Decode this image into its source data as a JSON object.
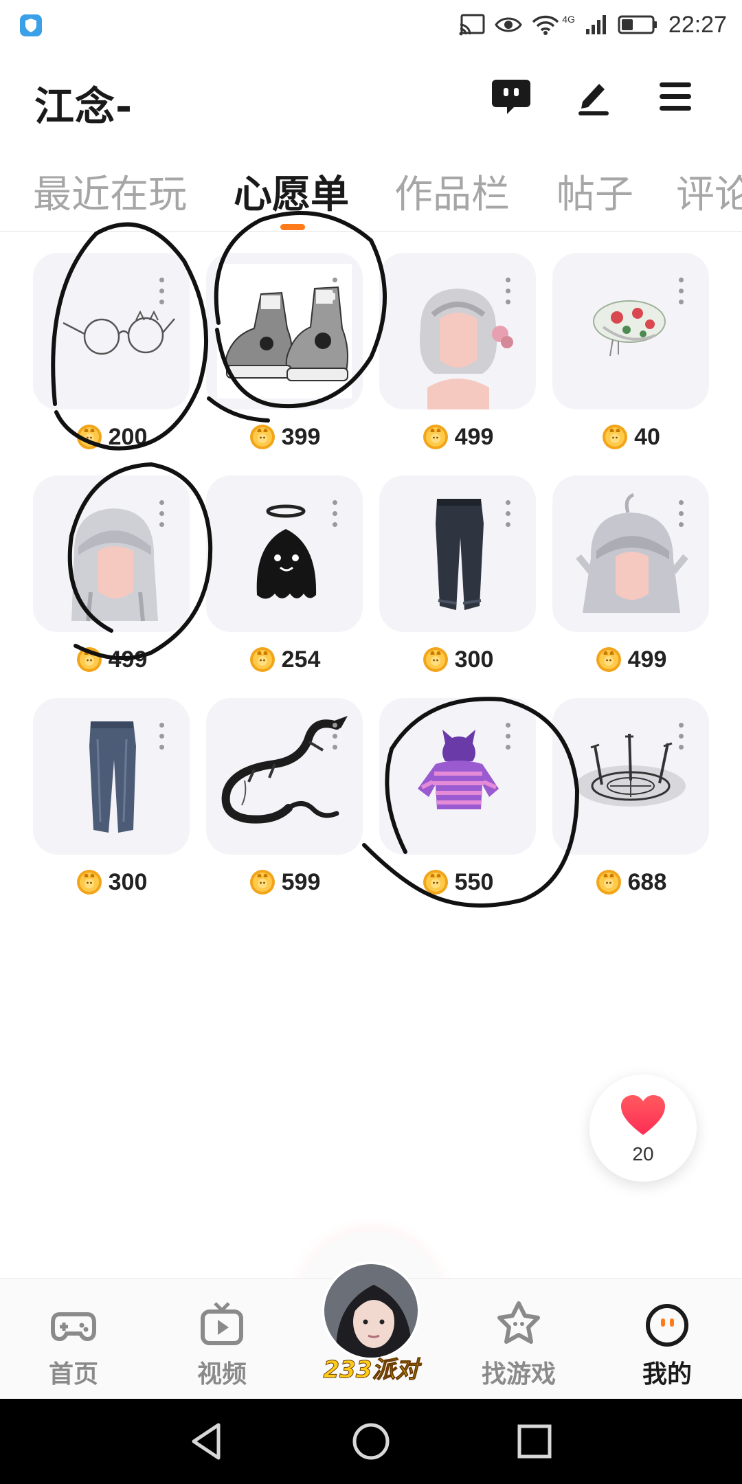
{
  "status_bar": {
    "time": "22:27",
    "network": "4G"
  },
  "header": {
    "username": "江念-",
    "icons": [
      "chat-bubble-icon",
      "edit-pen-icon",
      "hamburger-menu-icon"
    ]
  },
  "tabs": [
    {
      "label": "最近在玩",
      "active": false
    },
    {
      "label": "心愿单",
      "active": true
    },
    {
      "label": "作品栏",
      "active": false
    },
    {
      "label": "帖子",
      "active": false
    },
    {
      "label": "评论",
      "active": false
    }
  ],
  "wishlist": [
    {
      "item": "glasses",
      "price": "200"
    },
    {
      "item": "sneakers",
      "price": "399"
    },
    {
      "item": "silver-braided-hair",
      "price": "499"
    },
    {
      "item": "floral-beret",
      "price": "40"
    },
    {
      "item": "long-silver-hair",
      "price": "499"
    },
    {
      "item": "ghost-with-halo",
      "price": "254"
    },
    {
      "item": "dark-jeans",
      "price": "300"
    },
    {
      "item": "silver-hair-ahoge",
      "price": "499"
    },
    {
      "item": "blue-jeans",
      "price": "300"
    },
    {
      "item": "black-dragon",
      "price": "599"
    },
    {
      "item": "purple-striped-cat-hoodie",
      "price": "550"
    },
    {
      "item": "magic-circle-swords",
      "price": "688"
    }
  ],
  "like_float": {
    "count": "20"
  },
  "bottom_nav": {
    "items": [
      {
        "label": "首页",
        "icon": "gamepad-icon",
        "active": false
      },
      {
        "label": "视频",
        "icon": "tv-play-icon",
        "active": false
      },
      {
        "label": "233派对",
        "icon": "avatar-party",
        "active": false
      },
      {
        "label": "找游戏",
        "icon": "star-face-icon",
        "active": false
      },
      {
        "label": "我的",
        "icon": "smile-face-icon",
        "active": true
      }
    ]
  },
  "colors": {
    "accent": "#ff7a1a",
    "coin": "#f2a51a",
    "card_bg": "#f4f4f8",
    "heart": "#ff4a57"
  }
}
